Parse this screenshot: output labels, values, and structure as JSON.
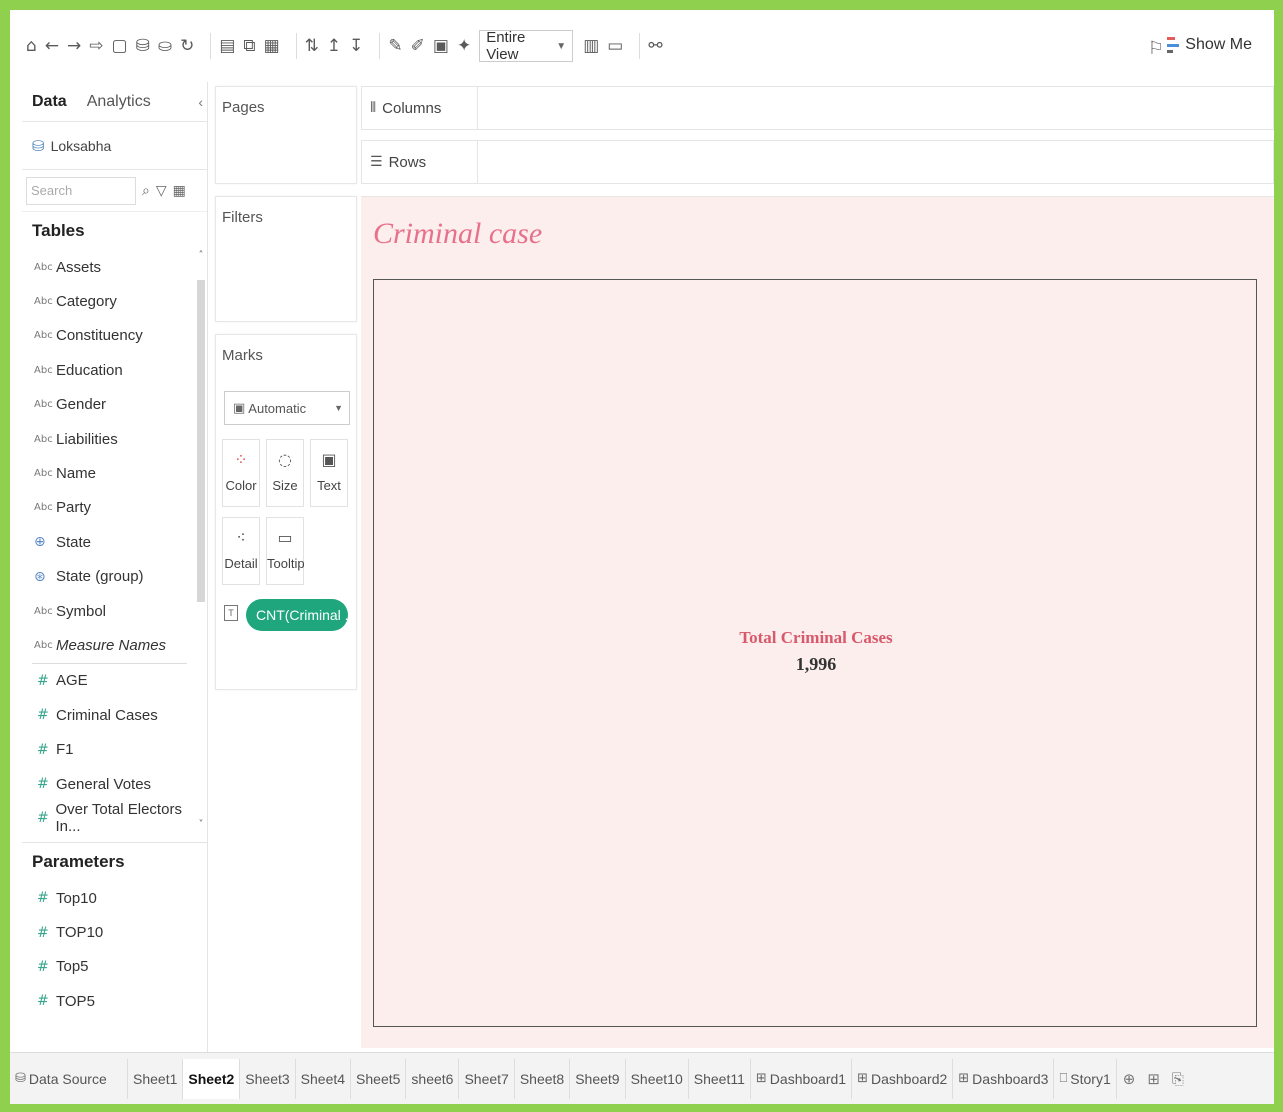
{
  "toolbar": {
    "view_size": "Entire View",
    "show_me": "Show Me"
  },
  "datapane": {
    "tabs": [
      "Data",
      "Analytics"
    ],
    "datasource": "Loksabha",
    "search_placeholder": "Search",
    "tables_title": "Tables",
    "dimensions": [
      {
        "name": "Assets",
        "type": "Abc"
      },
      {
        "name": "Category",
        "type": "Abc"
      },
      {
        "name": "Constituency",
        "type": "Abc"
      },
      {
        "name": "Education",
        "type": "Abc"
      },
      {
        "name": "Gender",
        "type": "Abc"
      },
      {
        "name": "Liabilities",
        "type": "Abc"
      },
      {
        "name": "Name",
        "type": "Abc"
      },
      {
        "name": "Party",
        "type": "Abc"
      },
      {
        "name": "State",
        "type": "geo"
      },
      {
        "name": "State (group)",
        "type": "geo-group"
      },
      {
        "name": "Symbol",
        "type": "Abc"
      },
      {
        "name": "Measure Names",
        "type": "Abc"
      }
    ],
    "measures": [
      "AGE",
      "Criminal Cases",
      "F1",
      "General Votes",
      "Over Total Electors In..."
    ],
    "parameters_title": "Parameters",
    "parameters": [
      "Top10",
      "TOP10",
      "Top5",
      "TOP5"
    ]
  },
  "shelves": {
    "pages": "Pages",
    "filters": "Filters",
    "marks": "Marks",
    "mark_type": "Automatic",
    "mark_buttons": [
      "Color",
      "Size",
      "Text",
      "Detail",
      "Tooltip"
    ],
    "pill": "CNT(Criminal ..",
    "columns": "Columns",
    "rows": "Rows"
  },
  "view": {
    "title": "Criminal case",
    "kpi_label": "Total Criminal Cases",
    "kpi_value": "1,996",
    "title_color": "#e8708b",
    "background": "#fbeeec"
  },
  "bottom_tabs": {
    "data_source": "Data Source",
    "sheets": [
      "Sheet1",
      "Sheet2",
      "Sheet3",
      "Sheet4",
      "Sheet5",
      "sheet6",
      "Sheet7",
      "Sheet8",
      "Sheet9",
      "Sheet10",
      "Sheet11"
    ],
    "active_sheet": "Sheet2",
    "dashboards": [
      "Dashboard1",
      "Dashboard2",
      "Dashboard3"
    ],
    "story": "Story1"
  }
}
